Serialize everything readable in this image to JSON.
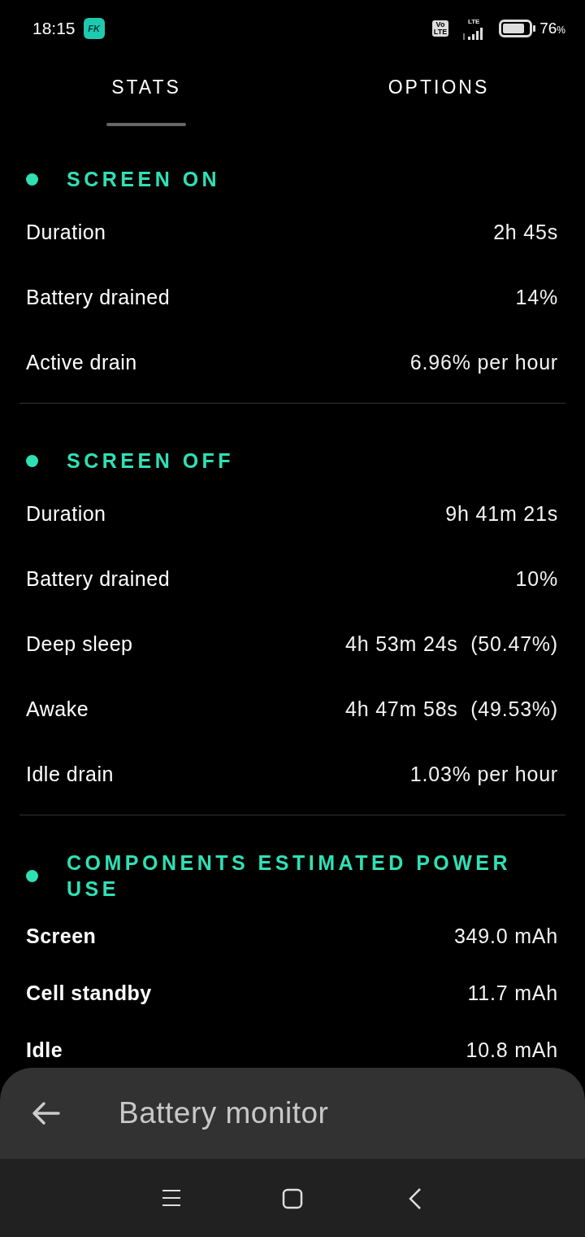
{
  "status_bar": {
    "time": "18:15",
    "app_icon_label": "FK",
    "volte": [
      "Vo",
      "LTE"
    ],
    "network": "LTE",
    "battery": "76",
    "battery_unit": "%"
  },
  "tabs": [
    {
      "label": "STATS",
      "selected": true
    },
    {
      "label": "OPTIONS",
      "selected": false
    }
  ],
  "sections": [
    {
      "title": "SCREEN ON",
      "kind": "timing",
      "rows": [
        {
          "label": "Duration",
          "value": "2h 45s"
        },
        {
          "label": "Battery drained",
          "value": "14%"
        },
        {
          "label": "Active drain",
          "value": "6.96% per hour"
        }
      ]
    },
    {
      "title": "SCREEN OFF",
      "kind": "timing",
      "rows": [
        {
          "label": "Duration",
          "value": "9h 41m 21s"
        },
        {
          "label": "Battery drained",
          "value": "10%"
        },
        {
          "label": "Deep sleep",
          "value": "4h 53m 24s  (50.47%)"
        },
        {
          "label": "Awake",
          "value": "4h 47m 58s  (49.53%)"
        },
        {
          "label": "Idle drain",
          "value": "1.03% per hour"
        }
      ]
    },
    {
      "title": "COMPONENTS ESTIMATED POWER USE",
      "kind": "components",
      "rows": [
        {
          "label": "Screen",
          "value": "349.0 mAh"
        },
        {
          "label": "Cell standby",
          "value": "11.7 mAh"
        },
        {
          "label": "Idle",
          "value": "10.8 mAh"
        }
      ]
    }
  ],
  "app_bar": {
    "title": "Battery monitor"
  }
}
